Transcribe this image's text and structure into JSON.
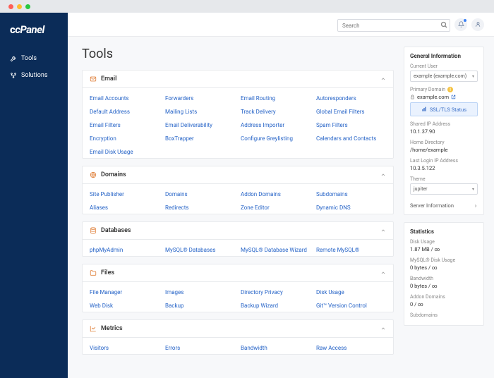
{
  "brand": "cPanel",
  "nav": {
    "tools": "Tools",
    "solutions": "Solutions"
  },
  "search": {
    "placeholder": "Search"
  },
  "page_title": "Tools",
  "sections": {
    "email": {
      "title": "Email",
      "links": [
        "Email Accounts",
        "Forwarders",
        "Email Routing",
        "Autoresponders",
        "Default Address",
        "Mailing Lists",
        "Track Delivery",
        "Global Email Filters",
        "Email Filters",
        "Email Deliverability",
        "Address Importer",
        "Spam Filters",
        "Encryption",
        "BoxTrapper",
        "Configure Greylisting",
        "Calendars and Contacts",
        "Email Disk Usage"
      ]
    },
    "domains": {
      "title": "Domains",
      "links": [
        "Site Publisher",
        "Domains",
        "Addon Domains",
        "Subdomains",
        "Aliases",
        "Redirects",
        "Zone Editor",
        "Dynamic DNS"
      ]
    },
    "databases": {
      "title": "Databases",
      "links": [
        "phpMyAdmin",
        "MySQL® Databases",
        "MySQL® Database Wizard",
        "Remote MySQL®"
      ]
    },
    "files": {
      "title": "Files",
      "links": [
        "File Manager",
        "Images",
        "Directory Privacy",
        "Disk Usage",
        "Web Disk",
        "Backup",
        "Backup Wizard",
        "Git™ Version Control"
      ]
    },
    "metrics": {
      "title": "Metrics",
      "links": [
        "Visitors",
        "Errors",
        "Bandwidth",
        "Raw Access"
      ]
    }
  },
  "general_info": {
    "title": "General Information",
    "current_user": {
      "label": "Current User",
      "value": "example (example.com)"
    },
    "primary_domain": {
      "label": "Primary Domain",
      "value": "example.com"
    },
    "ssl_button": "SSL/TLS Status",
    "shared_ip": {
      "label": "Shared IP Address",
      "value": "10.1.37.90"
    },
    "home_dir": {
      "label": "Home Directory",
      "value": "/home/example"
    },
    "last_login": {
      "label": "Last Login IP Address",
      "value": "10.3.5.122"
    },
    "theme": {
      "label": "Theme",
      "value": "jupiter"
    },
    "server_info": "Server Information"
  },
  "statistics": {
    "title": "Statistics",
    "disk_usage": {
      "label": "Disk Usage",
      "value": "1.87 MB / ∞"
    },
    "mysql_disk": {
      "label": "MySQL® Disk Usage",
      "value": "0 bytes / ∞"
    },
    "bandwidth": {
      "label": "Bandwidth",
      "value": "0 bytes / ∞"
    },
    "addon_domains": {
      "label": "Addon Domains",
      "value": "0 / ∞"
    },
    "subdomains": {
      "label": "Subdomains"
    }
  }
}
